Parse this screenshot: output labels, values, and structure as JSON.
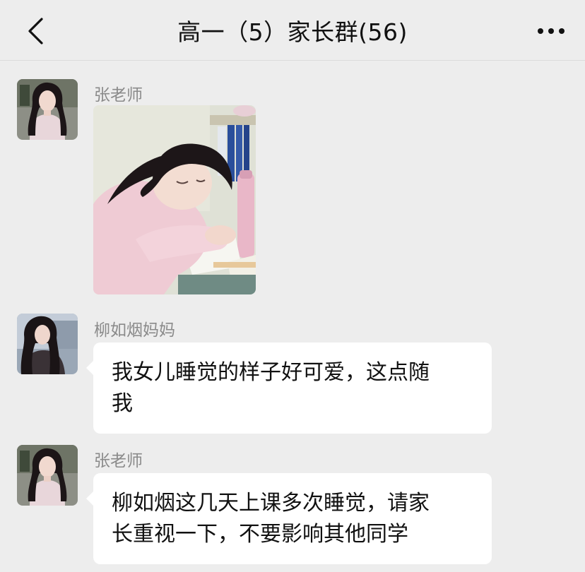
{
  "header": {
    "title": "高一（5）家长群(56)",
    "back_icon": "chevron-left-icon",
    "more_icon": "more-dots-icon"
  },
  "messages": [
    {
      "sender": "张老师",
      "type": "image",
      "image_desc_icon": "photo-girl-sleeping-at-desk"
    },
    {
      "sender": "柳如烟妈妈",
      "type": "text",
      "lines": [
        "我女儿睡觉的样子好可爱，这点随",
        "我"
      ]
    },
    {
      "sender": "张老师",
      "type": "text",
      "lines": [
        "柳如烟这几天上课多次睡觉，请家",
        "长重视一下，不要影响其他同学"
      ]
    }
  ],
  "colors": {
    "background": "#ededed",
    "bubble": "#ffffff",
    "sender_name": "#8a8a8a",
    "text": "#111111"
  }
}
